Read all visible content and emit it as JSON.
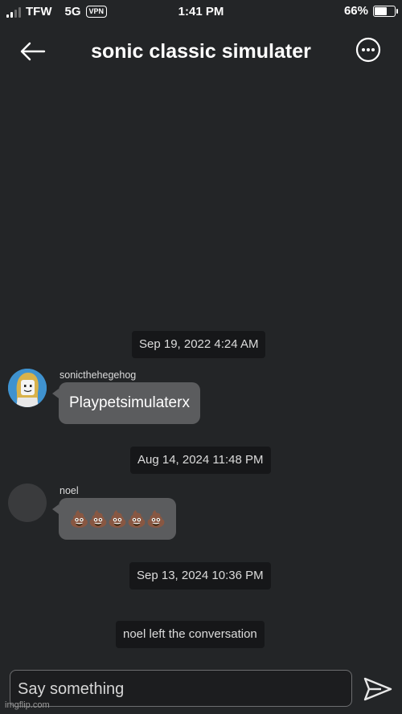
{
  "status_bar": {
    "carrier": "TFW",
    "network": "5G",
    "vpn": "VPN",
    "time": "1:41 PM",
    "battery": "66%",
    "battery_level": 0.66
  },
  "header": {
    "title": "sonic classic simulater"
  },
  "messages": [
    {
      "timestamp": "Sep 19, 2022 4:24 AM",
      "sender": "sonicthehegehog",
      "text": "Playpetsimulaterx"
    },
    {
      "timestamp": "Aug 14, 2024 11:48 PM",
      "sender": "noel",
      "text": "💩💩💩💩💩"
    }
  ],
  "system_event": {
    "timestamp": "Sep 13, 2024 10:36 PM",
    "text": "noel left the conversation"
  },
  "composer": {
    "placeholder": "Say something"
  },
  "watermark": "imgflip.com",
  "icons": {
    "back": "arrow-left-icon",
    "more": "more-options-icon",
    "send": "send-icon"
  },
  "colors": {
    "background": "#232527",
    "bubble": "#5b5c5e",
    "timestamp_pill": "#161719"
  }
}
